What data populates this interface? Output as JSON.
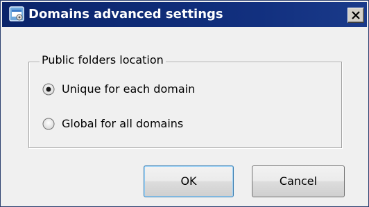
{
  "window": {
    "title": "Domains advanced settings",
    "close_label": "×"
  },
  "icons": {
    "app": "app-window-icon",
    "close": "close-icon"
  },
  "group": {
    "legend": "Public folders location",
    "options": [
      {
        "label": "Unique for each domain",
        "selected": true
      },
      {
        "label": "Global for all domains",
        "selected": false
      }
    ]
  },
  "buttons": {
    "ok_label": "OK",
    "cancel_label": "Cancel"
  },
  "colors": {
    "titlebar": "#0a246a",
    "dialog_bg": "#f0f0f0",
    "default_button_border": "#3c7fb1"
  }
}
